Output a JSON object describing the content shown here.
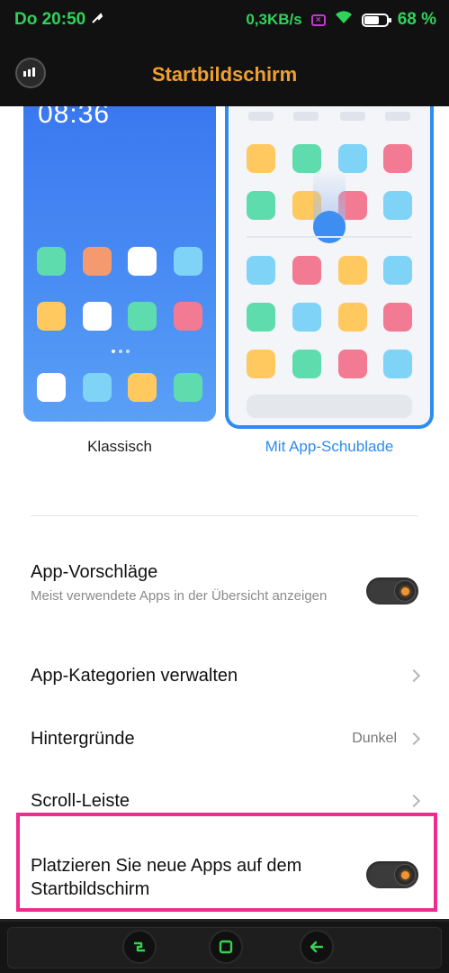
{
  "status_bar": {
    "time": "Do 20:50",
    "net_speed": "0,3KB/s",
    "battery": "68 %",
    "battery_level": 0.68,
    "icons": [
      "wrench-icon",
      "sim-x-icon",
      "wifi-icon",
      "battery-icon"
    ],
    "text_color": "#2fd35a"
  },
  "header": {
    "title": "Startbildschirm",
    "title_color": "#f0a030",
    "back_icon": "back-icon"
  },
  "layouts": {
    "classic": {
      "label": "Klassisch",
      "clock": "08:36"
    },
    "drawer": {
      "label": "Mit App-Schublade",
      "selected": true,
      "accent": "#2d8cf0"
    }
  },
  "settings": [
    {
      "title": "App-Vorschläge",
      "subtitle": "Meist verwendete Apps in der Übersicht anzeigen",
      "control": "toggle",
      "state": "on"
    },
    {
      "title": "App-Kategorien verwalten",
      "control": "chevron"
    },
    {
      "title": "Hintergründe",
      "value": "Dunkel",
      "control": "chevron"
    },
    {
      "title": "Scroll-Leiste",
      "control": "chevron"
    },
    {
      "title": "Platzieren Sie neue Apps auf dem Startbildschirm",
      "control": "toggle",
      "state": "on",
      "highlight_color": "#f02a8f"
    }
  ],
  "navbar": {
    "buttons": [
      "recents-button",
      "home-button",
      "back-button"
    ],
    "accent": "#3ad050"
  }
}
